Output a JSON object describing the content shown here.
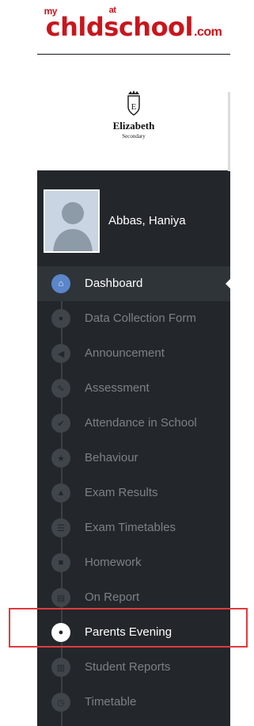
{
  "brand": {
    "my": "my",
    "child": "chld",
    "at": "at",
    "school": "school",
    "com": ".com"
  },
  "school": {
    "name": "Elizabeth",
    "subtitle": "Secondary"
  },
  "student": {
    "name": "Abbas, Haniya"
  },
  "menu": {
    "items": [
      {
        "label": "Dashboard",
        "icon": "home-icon"
      },
      {
        "label": "Data Collection Form",
        "icon": "user-icon"
      },
      {
        "label": "Announcement",
        "icon": "megaphone-icon"
      },
      {
        "label": "Assessment",
        "icon": "pencil-icon"
      },
      {
        "label": "Attendance in School",
        "icon": "check-icon"
      },
      {
        "label": "Behaviour",
        "icon": "star-icon"
      },
      {
        "label": "Exam Results",
        "icon": "graduation-cap-icon"
      },
      {
        "label": "Exam Timetables",
        "icon": "list-icon"
      },
      {
        "label": "Homework",
        "icon": "briefcase-icon"
      },
      {
        "label": "On Report",
        "icon": "document-icon"
      },
      {
        "label": "Parents Evening",
        "icon": "users-icon"
      },
      {
        "label": "Student Reports",
        "icon": "report-icon"
      },
      {
        "label": "Timetable",
        "icon": "clock-icon"
      }
    ]
  },
  "colors": {
    "sidebar_bg": "#23272b",
    "active_accent": "#5b86c9",
    "brand_red": "#c8161d",
    "annotation_red": "#e03a3e"
  }
}
